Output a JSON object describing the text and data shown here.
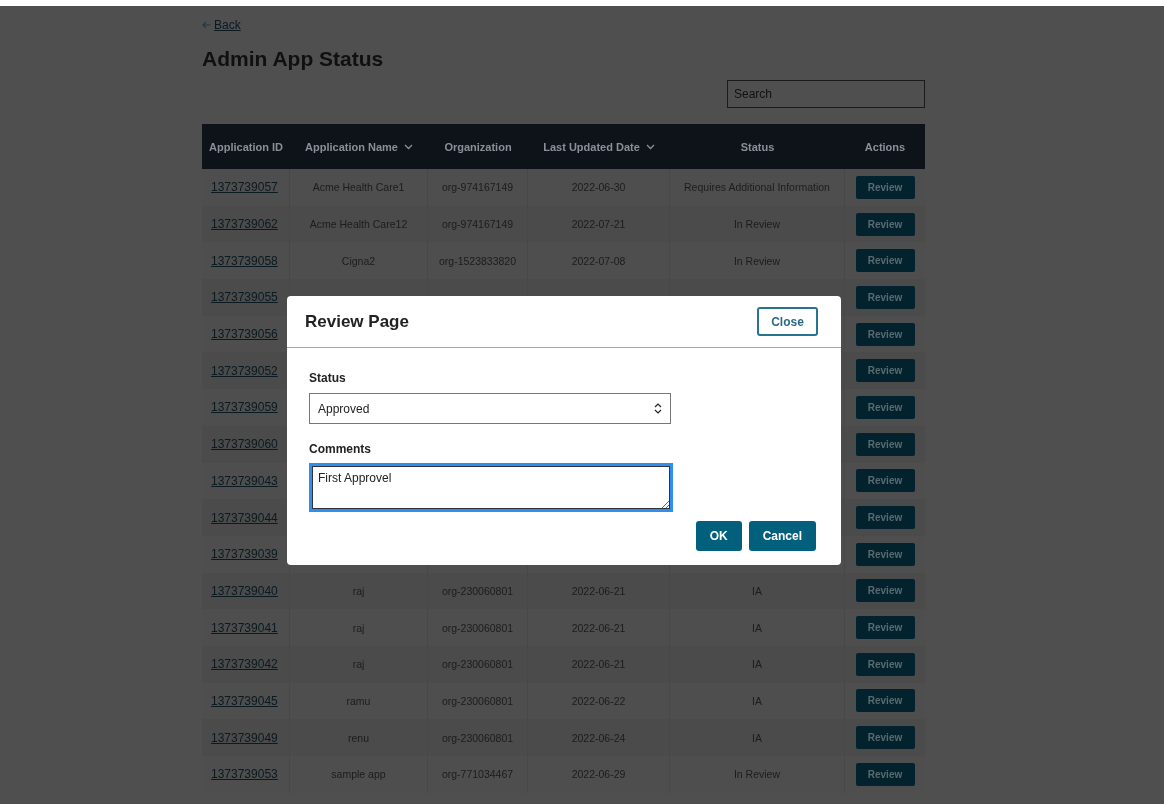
{
  "back_link": {
    "label": "Back"
  },
  "page_title": "Admin App Status",
  "search": {
    "placeholder": "Search"
  },
  "table": {
    "columns": [
      {
        "label": "Application ID",
        "sortable": false
      },
      {
        "label": "Application Name",
        "sortable": true
      },
      {
        "label": "Organization",
        "sortable": false
      },
      {
        "label": "Last Updated Date",
        "sortable": true
      },
      {
        "label": "Status",
        "sortable": false
      },
      {
        "label": "Actions",
        "sortable": false
      }
    ],
    "rows": [
      {
        "id": "1373739057",
        "name": "Acme Health Care1",
        "organization": "org-974167149",
        "date": "2022-06-30",
        "status": "Requires Additional Information",
        "action": "Review"
      },
      {
        "id": "1373739062",
        "name": "Acme Health Care12",
        "organization": "org-974167149",
        "date": "2022-07-21",
        "status": "In Review",
        "action": "Review"
      },
      {
        "id": "1373739058",
        "name": "Cigna2",
        "organization": "org-1523833820",
        "date": "2022-07-08",
        "status": "In Review",
        "action": "Review"
      },
      {
        "id": "1373739055",
        "action": "Review"
      },
      {
        "id": "1373739056",
        "action": "Review"
      },
      {
        "id": "1373739052",
        "action": "Review"
      },
      {
        "id": "1373739059",
        "action": "Review"
      },
      {
        "id": "1373739060",
        "action": "Review"
      },
      {
        "id": "1373739043",
        "action": "Review"
      },
      {
        "id": "1373739044",
        "action": "Review"
      },
      {
        "id": "1373739039",
        "action": "Review"
      },
      {
        "id": "1373739040",
        "name": "raj",
        "organization": "org-230060801",
        "date": "2022-06-21",
        "status": "IA",
        "action": "Review"
      },
      {
        "id": "1373739041",
        "name": "raj",
        "organization": "org-230060801",
        "date": "2022-06-21",
        "status": "IA",
        "action": "Review"
      },
      {
        "id": "1373739042",
        "name": "raj",
        "organization": "org-230060801",
        "date": "2022-06-21",
        "status": "IA",
        "action": "Review"
      },
      {
        "id": "1373739045",
        "name": "ramu",
        "organization": "org-230060801",
        "date": "2022-06-22",
        "status": "IA",
        "action": "Review"
      },
      {
        "id": "1373739049",
        "name": "renu",
        "organization": "org-230060801",
        "date": "2022-06-24",
        "status": "IA",
        "action": "Review"
      },
      {
        "id": "1373739053",
        "name": "sample app",
        "organization": "org-771034467",
        "date": "2022-06-29",
        "status": "In Review",
        "action": "Review"
      }
    ]
  },
  "modal": {
    "title": "Review Page",
    "close_button": "Close",
    "status_field": {
      "label": "Status",
      "value": "Approved"
    },
    "comments_field": {
      "label": "Comments",
      "value": "First Approvel"
    },
    "buttons": [
      "OK",
      "Cancel"
    ]
  }
}
